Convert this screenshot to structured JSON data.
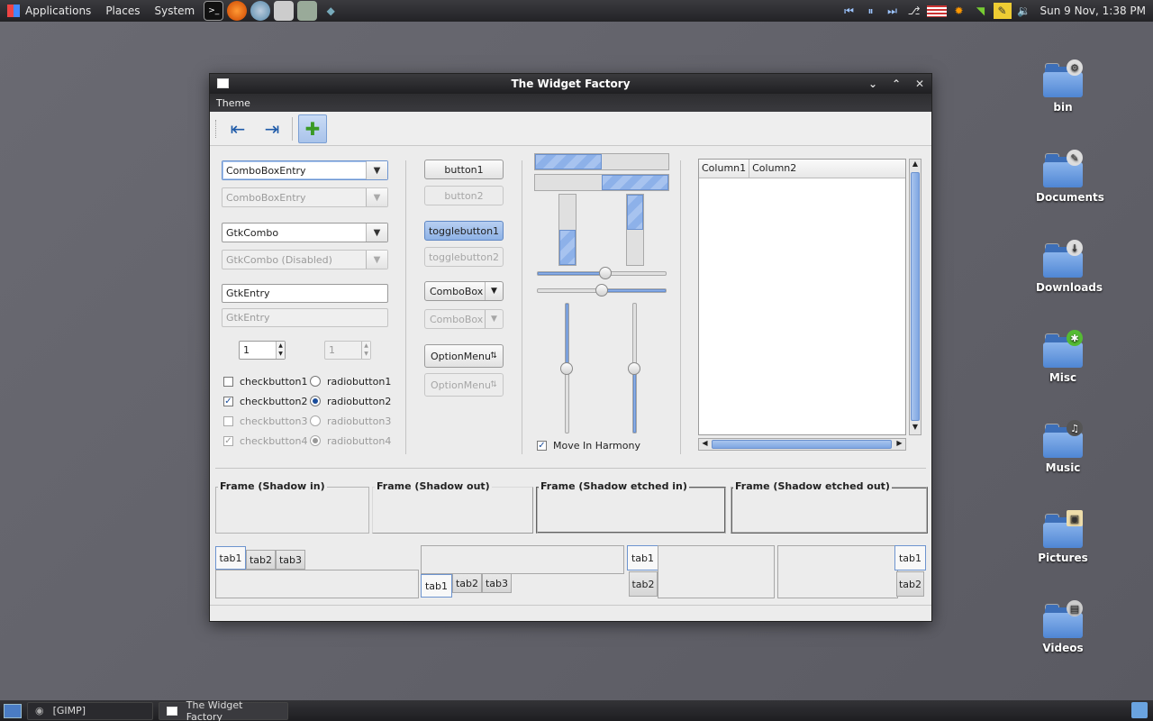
{
  "top_panel": {
    "menus": [
      "Applications",
      "Places",
      "System"
    ],
    "launchers": [
      "terminal-icon",
      "firefox-icon",
      "thunderbird-icon",
      "files-icon",
      "package-icon",
      "drop-icon"
    ],
    "clock": "Sun  9 Nov,  1:38 PM"
  },
  "bottom_panel": {
    "tasks": [
      "[GIMP]",
      "The Widget Factory"
    ]
  },
  "desktop": {
    "icons": [
      "bin",
      "Documents",
      "Downloads",
      "Misc",
      "Music",
      "Pictures",
      "Videos"
    ]
  },
  "window": {
    "title": "The Widget Factory",
    "menu": "Theme",
    "combos": {
      "combo_entry": "ComboBoxEntry",
      "combo_entry_disabled": "ComboBoxEntry",
      "gtk_combo": "GtkCombo",
      "gtk_combo_disabled": "GtkCombo (Disabled)"
    },
    "entries": {
      "entry": "GtkEntry",
      "entry_disabled": "GtkEntry"
    },
    "spins": {
      "spin1": "1",
      "spin2": "1"
    },
    "checks": [
      "checkbutton1",
      "checkbutton2",
      "checkbutton3",
      "checkbutton4"
    ],
    "radios": [
      "radiobutton1",
      "radiobutton2",
      "radiobutton3",
      "radiobutton4"
    ],
    "buttons": {
      "button1": "button1",
      "button2": "button2",
      "toggle1": "togglebutton1",
      "toggle2": "togglebutton2",
      "combobox": "ComboBox",
      "combobox_disabled": "ComboBox",
      "optionmenu": "OptionMenu",
      "optionmenu_disabled": "OptionMenu"
    },
    "move_in_harmony": "Move In Harmony",
    "tree": {
      "columns": [
        "Column1",
        "Column2"
      ]
    },
    "frames": [
      "Frame (Shadow in)",
      "Frame (Shadow out)",
      "Frame (Shadow etched in)",
      "Frame (Shadow etched out)"
    ],
    "tabs": {
      "top": [
        "tab1",
        "tab2",
        "tab3"
      ],
      "bottom": [
        "tab1",
        "tab2",
        "tab3"
      ],
      "left": [
        "tab1",
        "tab2"
      ],
      "right": [
        "tab1",
        "tab2"
      ]
    },
    "levels": {
      "progress_h1": 0.5,
      "progress_h2": 0.5,
      "progress_v1": 0.5,
      "progress_v2": 0.5,
      "hscale1": 0.53,
      "hscale2": 0.5,
      "vscale1": 0.5,
      "vscale2": 0.5
    }
  }
}
